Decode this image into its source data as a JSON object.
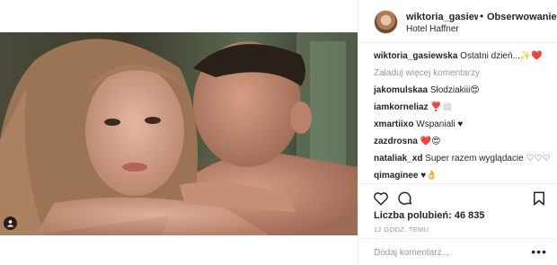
{
  "header": {
    "username": "wiktoria_gasiewska",
    "separator": "•",
    "follow_label": "Obserwowanie",
    "location": "Hotel Haffner"
  },
  "caption": {
    "username": "wiktoria_gasiewska",
    "text": "Ostatni dzień...✨❤️"
  },
  "load_more_label": "Załaduj więcej komentarzy",
  "comments": [
    {
      "user": "jakomulskaa",
      "text": "Słodziakiii😍"
    },
    {
      "user": "iamkorneliaz",
      "text": "❣️◻️"
    },
    {
      "user": "xmartiixo",
      "text": "Wspaniali ♥"
    },
    {
      "user": "zazdrosna",
      "text": "❤️😍"
    },
    {
      "user": "nataliak_xd",
      "text": "Super razem wyglądacie ♡♡♡"
    },
    {
      "user": "qimaginee",
      "text": "♥👌"
    }
  ],
  "likes": {
    "label": "Liczba polubień:",
    "count": "46 835"
  },
  "time": "12 GODZ. TEMU",
  "add_comment": {
    "placeholder": "Dodaj komentarz..."
  },
  "more_label": "•••",
  "icons": {
    "like": "heart-icon",
    "comment": "comment-icon",
    "save": "bookmark-icon",
    "tag": "user-tag-icon",
    "more": "more-icon"
  },
  "colors": {
    "border": "#efefef",
    "text": "#262626",
    "muted": "#999999"
  }
}
